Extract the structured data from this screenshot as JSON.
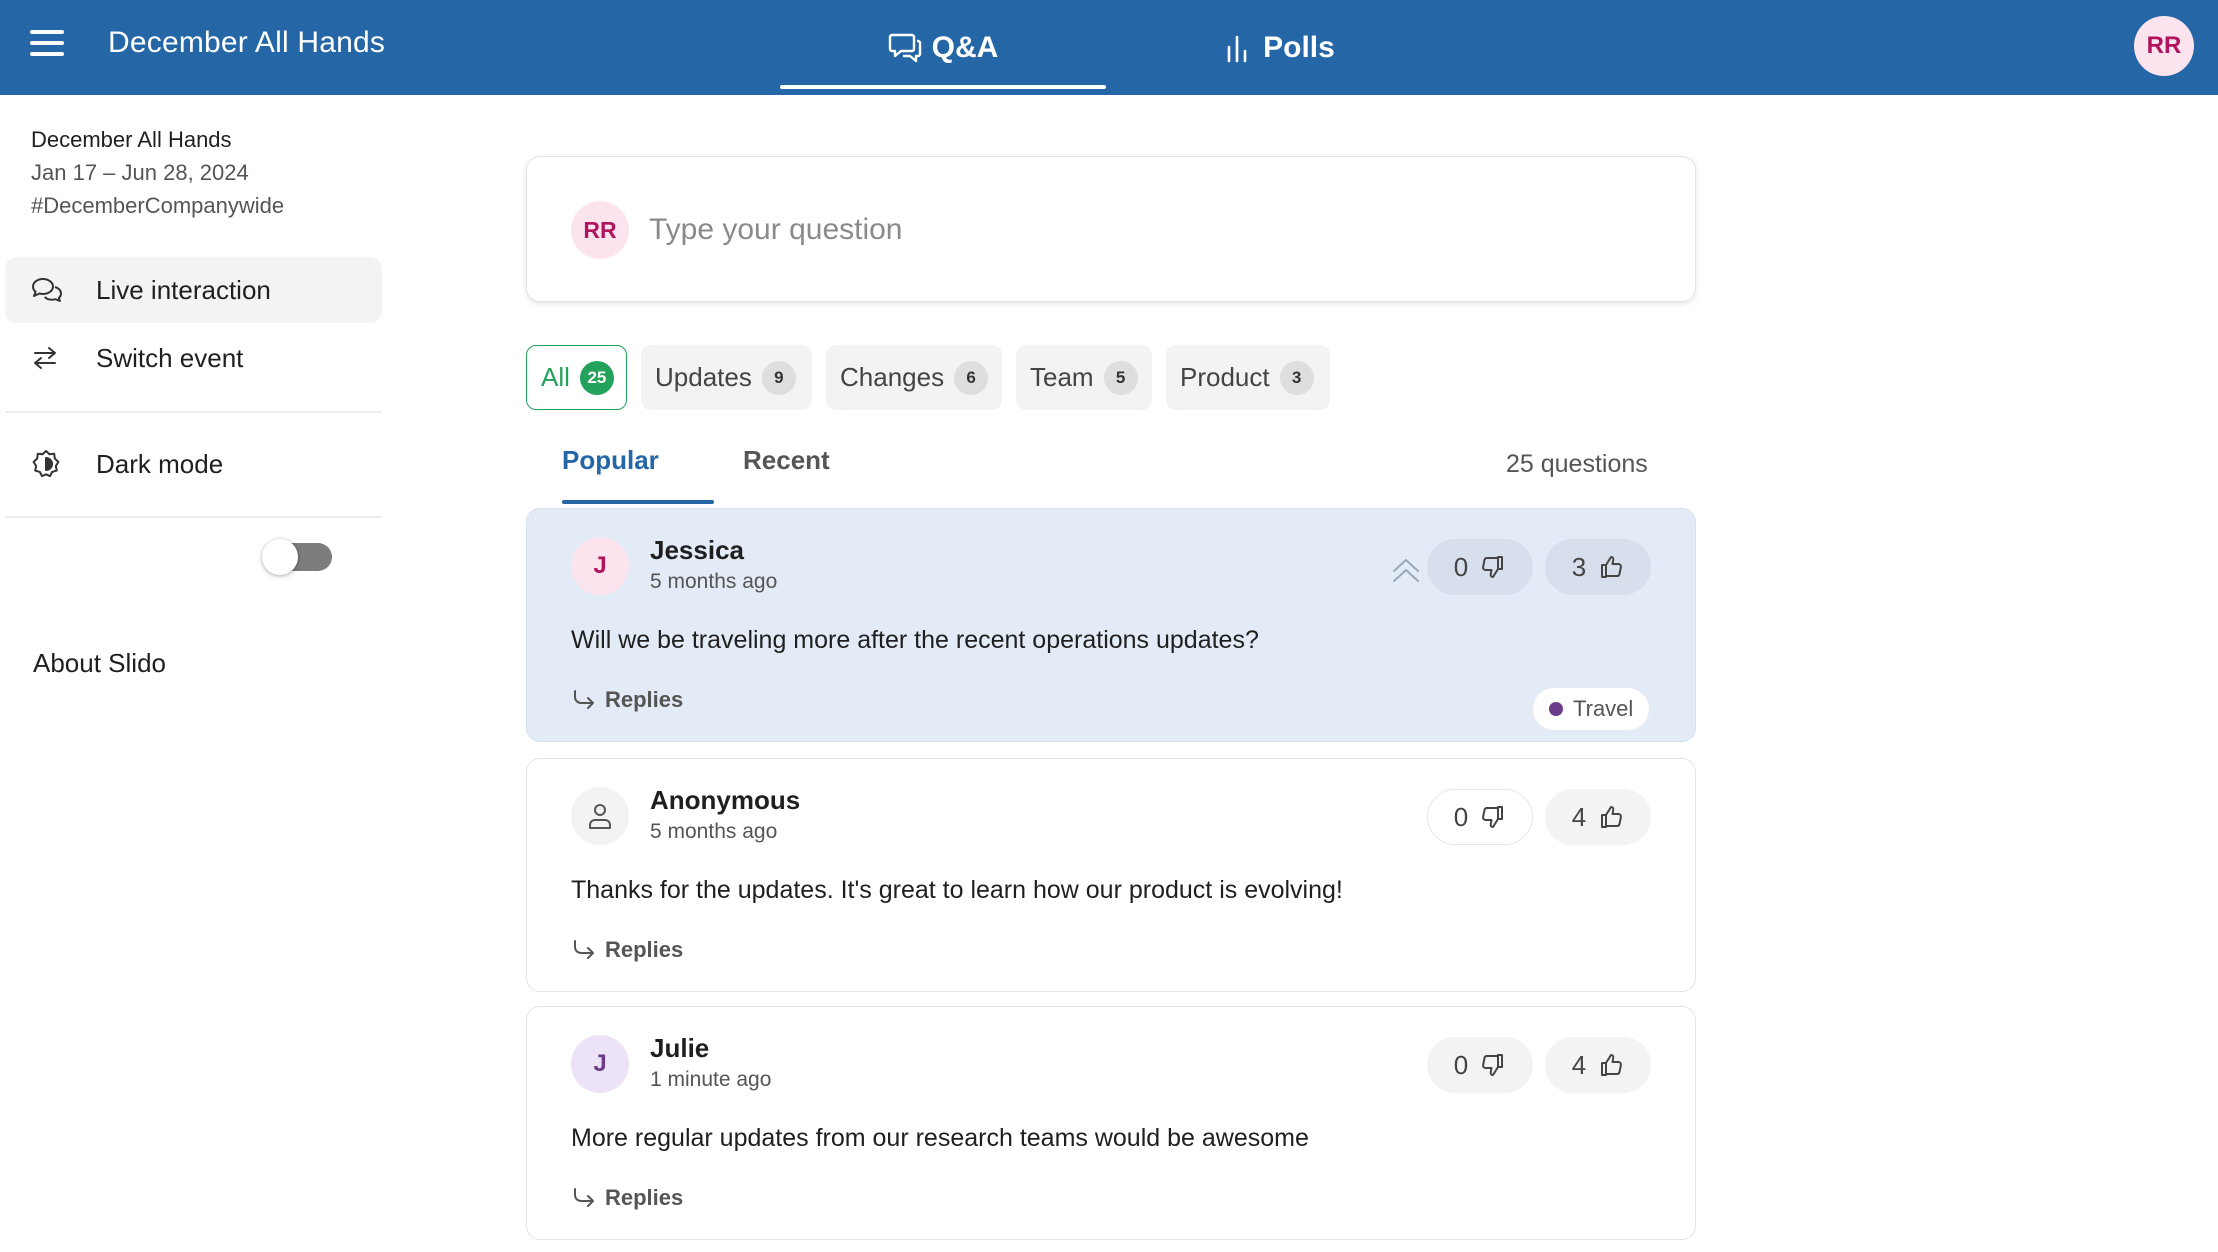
{
  "header": {
    "title": "December All Hands",
    "tabs": [
      {
        "label": "Q&A",
        "active": true
      },
      {
        "label": "Polls",
        "active": false
      }
    ],
    "user_initials": "RR",
    "brand_color": "#2567a6"
  },
  "sidebar": {
    "event_name": "December All Hands",
    "event_dates": "Jan 17 – Jun 28, 2024",
    "event_code": "#DecemberCompanywide",
    "items": [
      {
        "label": "Live interaction",
        "icon": "chat-bubbles-icon",
        "active": true
      },
      {
        "label": "Switch event",
        "icon": "swap-arrows-icon",
        "active": false
      }
    ],
    "dark_mode_label": "Dark mode",
    "dark_mode_on": false,
    "about_label": "About Slido"
  },
  "ask": {
    "avatar_initials": "RR",
    "placeholder": "Type your question"
  },
  "filters": [
    {
      "label": "All",
      "count": "25",
      "active": true
    },
    {
      "label": "Updates",
      "count": "9",
      "active": false
    },
    {
      "label": "Changes",
      "count": "6",
      "active": false
    },
    {
      "label": "Team",
      "count": "5",
      "active": false
    },
    {
      "label": "Product",
      "count": "3",
      "active": false
    }
  ],
  "sort": {
    "popular": "Popular",
    "recent": "Recent",
    "count_label": "25 questions"
  },
  "questions": [
    {
      "avatar": "J",
      "author": "Jessica",
      "time": "5 months ago",
      "text": "Will we be traveling more after the recent operations updates?",
      "downvotes": "0",
      "upvotes": "3",
      "replies_label": "Replies",
      "tag": "Travel",
      "tag_color": "#6b3c8a"
    },
    {
      "avatar": "",
      "author": "Anonymous",
      "time": "5 months ago",
      "text": "Thanks for the updates. It's great to learn how our product is evolving!",
      "downvotes": "0",
      "upvotes": "4",
      "replies_label": "Replies"
    },
    {
      "avatar": "J",
      "author": "Julie",
      "time": "1 minute ago",
      "text": "More regular updates from our research teams would be awesome",
      "downvotes": "0",
      "upvotes": "4",
      "replies_label": "Replies"
    }
  ]
}
